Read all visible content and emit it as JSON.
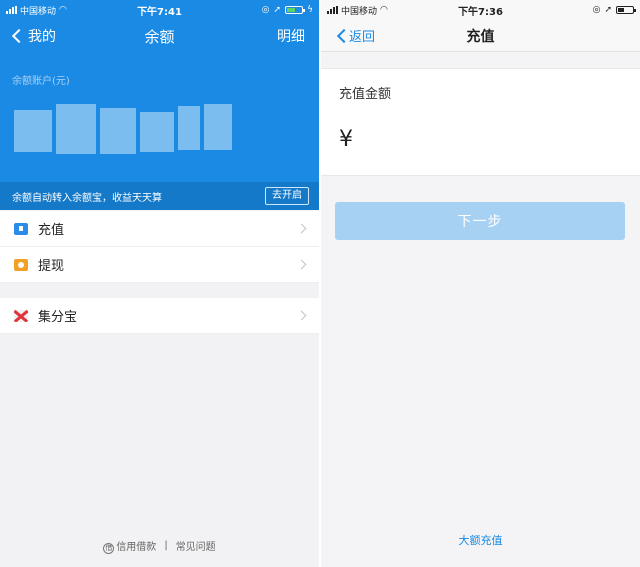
{
  "left": {
    "status": {
      "carrier": "中国移动",
      "time": "下午7:41"
    },
    "nav": {
      "back_label": "我的",
      "title": "余额",
      "right_label": "明细"
    },
    "account_label": "余额账户(元)",
    "promo": {
      "text": "余额自动转入余额宝，收益天天算",
      "button": "去开启"
    },
    "menu": [
      {
        "label": "充值",
        "icon": "recharge-icon"
      },
      {
        "label": "提现",
        "icon": "withdraw-icon"
      }
    ],
    "menu2": [
      {
        "label": "集分宝",
        "icon": "jifenbao-icon"
      }
    ],
    "footer": {
      "link1": "信用借款",
      "separator": "|",
      "link2": "常见问题"
    }
  },
  "right": {
    "status": {
      "carrier": "中国移动",
      "time": "下午7:36"
    },
    "nav": {
      "back_label": "返回",
      "title": "充值"
    },
    "amount_label": "充值金额",
    "currency_symbol": "¥",
    "next_button": "下一步",
    "large_recharge_link": "大额充值"
  },
  "colors": {
    "brand_blue": "#1a8ae4",
    "button_disabled": "#a7d1f3",
    "withdraw_orange": "#f2a026",
    "jifen_red": "#e0343c"
  }
}
